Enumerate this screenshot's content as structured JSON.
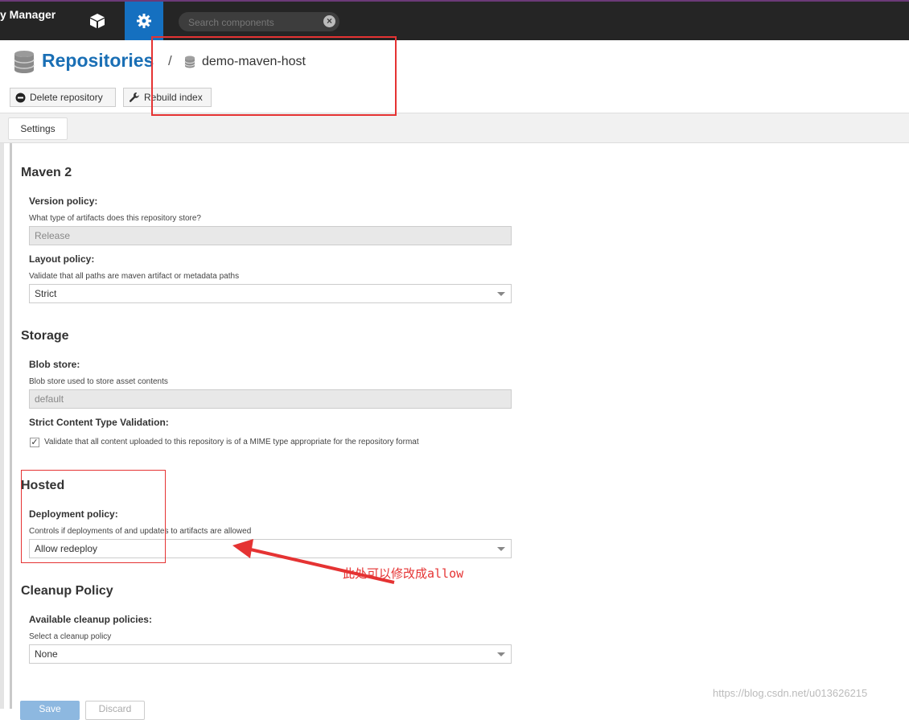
{
  "app": {
    "brand_title": "y Manager"
  },
  "search": {
    "placeholder": "Search components",
    "clear_icon": "×"
  },
  "header": {
    "title": "Repositories",
    "separator": "/",
    "repository_name": "demo-maven-host"
  },
  "toolbar": {
    "delete_label": "Delete repository",
    "rebuild_label": "Rebuild index"
  },
  "tabs": [
    {
      "label": "Settings"
    }
  ],
  "form": {
    "maven": {
      "title": "Maven 2",
      "version_policy": {
        "label": "Version policy:",
        "help": "What type of artifacts does this repository store?",
        "value": "Release"
      },
      "layout_policy": {
        "label": "Layout policy:",
        "help": "Validate that all paths are maven artifact or metadata paths",
        "value": "Strict"
      }
    },
    "storage": {
      "title": "Storage",
      "blob_store": {
        "label": "Blob store:",
        "help": "Blob store used to store asset contents",
        "value": "default"
      },
      "strict_validation": {
        "label": "Strict Content Type Validation:",
        "checkbox_label": "Validate that all content uploaded to this repository is of a MIME type appropriate for the repository format",
        "checked": true
      }
    },
    "hosted": {
      "title": "Hosted",
      "deployment_policy": {
        "label": "Deployment policy:",
        "help": "Controls if deployments of and updates to artifacts are allowed",
        "value": "Allow redeploy"
      }
    },
    "cleanup": {
      "title": "Cleanup Policy",
      "available": {
        "label": "Available cleanup policies:",
        "help": "Select a cleanup policy",
        "value": "None"
      }
    }
  },
  "footer_buttons": {
    "save_label": "Save",
    "discard_label": "Discard"
  },
  "annotation": {
    "text": "此处可以修改成allow",
    "color": "#e53333"
  },
  "watermark": "https://blog.csdn.net/u013626215",
  "colors": {
    "topbar": "#252525",
    "admin_active": "#1570c0",
    "title_blue": "#1a6fb5",
    "annotation_red": "#e53333"
  },
  "icons": {
    "browse": "cube-icon",
    "admin": "gear-icon",
    "repository": "database-icon",
    "delete": "minus-circle-icon",
    "rebuild": "wrench-icon",
    "check": "checkmark-icon"
  }
}
